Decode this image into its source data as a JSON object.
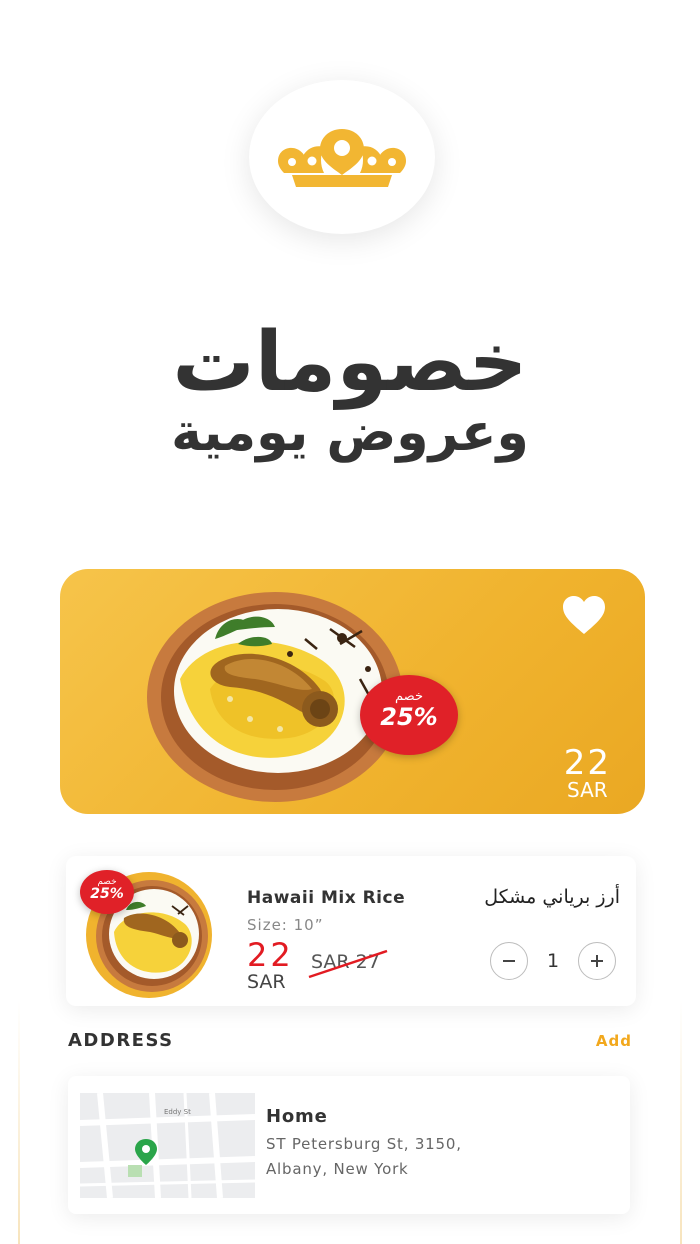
{
  "colors": {
    "accent": "#f2b632",
    "badge": "#e02128",
    "price_red": "#e21b22",
    "add_link": "#f2a81d"
  },
  "logo": {
    "icon": "crown-pin-icon"
  },
  "headline": {
    "line1": "خصومات",
    "line2": "وعروض يومية"
  },
  "banner": {
    "discount_label": "خصم",
    "discount_value": "25%",
    "price": "22",
    "currency": "SAR",
    "icon": "heart-icon"
  },
  "cart_item": {
    "discount_label": "خصم",
    "discount_value": "25%",
    "title_en": "Hawaii Mix Rice",
    "title_ar": "أرز برياني مشكل",
    "size": "Size: 10”",
    "price": "22",
    "currency": "SAR",
    "old_price": "SAR 27",
    "quantity": "1",
    "minus_icon": "minus-icon",
    "plus_icon": "plus-icon"
  },
  "address": {
    "title": "ADDRESS",
    "add_label": "Add",
    "name": "Home",
    "line1": "ST Petersburg St, 3150,",
    "line2": "Albany, New York",
    "map_street_label": "Eddy St"
  }
}
